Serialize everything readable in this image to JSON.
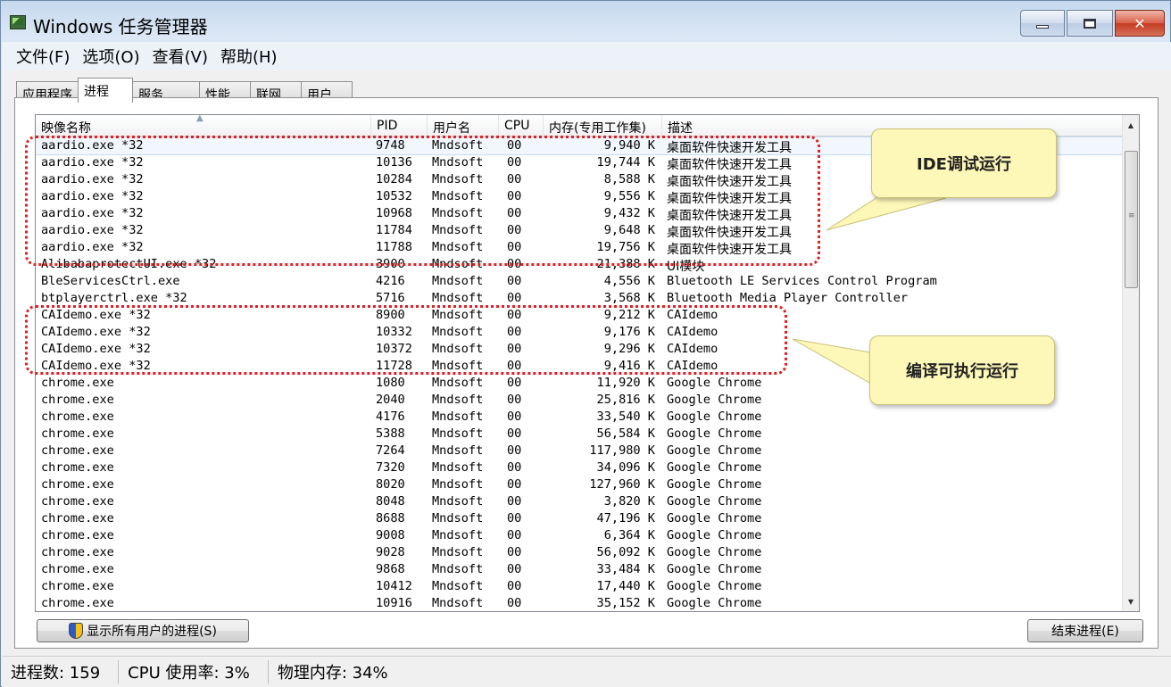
{
  "window": {
    "title": "Windows 任务管理器",
    "minimize_label": "",
    "maximize_label": "",
    "close_label": "✕"
  },
  "menu": [
    "文件(F)",
    "选项(O)",
    "查看(V)",
    "帮助(H)"
  ],
  "tabs": [
    {
      "label": "应用程序",
      "active": false
    },
    {
      "label": "进程",
      "active": true
    },
    {
      "label": "服务",
      "active": false
    },
    {
      "label": "性能",
      "active": false
    },
    {
      "label": "联网",
      "active": false
    },
    {
      "label": "用户",
      "active": false
    }
  ],
  "columns": {
    "name": "映像名称",
    "pid": "PID",
    "user": "用户名",
    "cpu": "CPU",
    "mem": "内存(专用工作集)",
    "desc": "描述"
  },
  "processes": [
    {
      "name": "aardio.exe *32",
      "pid": "9748",
      "user": "Mndsoft",
      "cpu": "00",
      "mem": "9,940 K",
      "desc": "桌面软件快速开发工具",
      "selected": true
    },
    {
      "name": "aardio.exe *32",
      "pid": "10136",
      "user": "Mndsoft",
      "cpu": "00",
      "mem": "19,744 K",
      "desc": "桌面软件快速开发工具"
    },
    {
      "name": "aardio.exe *32",
      "pid": "10284",
      "user": "Mndsoft",
      "cpu": "00",
      "mem": "8,588 K",
      "desc": "桌面软件快速开发工具"
    },
    {
      "name": "aardio.exe *32",
      "pid": "10532",
      "user": "Mndsoft",
      "cpu": "00",
      "mem": "9,556 K",
      "desc": "桌面软件快速开发工具"
    },
    {
      "name": "aardio.exe *32",
      "pid": "10968",
      "user": "Mndsoft",
      "cpu": "00",
      "mem": "9,432 K",
      "desc": "桌面软件快速开发工具"
    },
    {
      "name": "aardio.exe *32",
      "pid": "11784",
      "user": "Mndsoft",
      "cpu": "00",
      "mem": "9,648 K",
      "desc": "桌面软件快速开发工具"
    },
    {
      "name": "aardio.exe *32",
      "pid": "11788",
      "user": "Mndsoft",
      "cpu": "00",
      "mem": "19,756 K",
      "desc": "桌面软件快速开发工具"
    },
    {
      "name": "AlibabaprotectUI.exe *32",
      "pid": "3900",
      "user": "Mndsoft",
      "cpu": "00",
      "mem": "21,388 K",
      "desc": "UI模块"
    },
    {
      "name": "BleServicesCtrl.exe",
      "pid": "4216",
      "user": "Mndsoft",
      "cpu": "00",
      "mem": "4,556 K",
      "desc": "Bluetooth LE Services Control Program"
    },
    {
      "name": "btplayerctrl.exe *32",
      "pid": "5716",
      "user": "Mndsoft",
      "cpu": "00",
      "mem": "3,568 K",
      "desc": "Bluetooth Media Player Controller"
    },
    {
      "name": "CAIdemo.exe *32",
      "pid": "8900",
      "user": "Mndsoft",
      "cpu": "00",
      "mem": "9,212 K",
      "desc": "CAIdemo"
    },
    {
      "name": "CAIdemo.exe *32",
      "pid": "10332",
      "user": "Mndsoft",
      "cpu": "00",
      "mem": "9,176 K",
      "desc": "CAIdemo"
    },
    {
      "name": "CAIdemo.exe *32",
      "pid": "10372",
      "user": "Mndsoft",
      "cpu": "00",
      "mem": "9,296 K",
      "desc": "CAIdemo"
    },
    {
      "name": "CAIdemo.exe *32",
      "pid": "11728",
      "user": "Mndsoft",
      "cpu": "00",
      "mem": "9,416 K",
      "desc": "CAIdemo"
    },
    {
      "name": "chrome.exe",
      "pid": "1080",
      "user": "Mndsoft",
      "cpu": "00",
      "mem": "11,920 K",
      "desc": "Google Chrome"
    },
    {
      "name": "chrome.exe",
      "pid": "2040",
      "user": "Mndsoft",
      "cpu": "00",
      "mem": "25,816 K",
      "desc": "Google Chrome"
    },
    {
      "name": "chrome.exe",
      "pid": "4176",
      "user": "Mndsoft",
      "cpu": "00",
      "mem": "33,540 K",
      "desc": "Google Chrome"
    },
    {
      "name": "chrome.exe",
      "pid": "5388",
      "user": "Mndsoft",
      "cpu": "00",
      "mem": "56,584 K",
      "desc": "Google Chrome"
    },
    {
      "name": "chrome.exe",
      "pid": "7264",
      "user": "Mndsoft",
      "cpu": "00",
      "mem": "117,980 K",
      "desc": "Google Chrome"
    },
    {
      "name": "chrome.exe",
      "pid": "7320",
      "user": "Mndsoft",
      "cpu": "00",
      "mem": "34,096 K",
      "desc": "Google Chrome"
    },
    {
      "name": "chrome.exe",
      "pid": "8020",
      "user": "Mndsoft",
      "cpu": "00",
      "mem": "127,960 K",
      "desc": "Google Chrome"
    },
    {
      "name": "chrome.exe",
      "pid": "8048",
      "user": "Mndsoft",
      "cpu": "00",
      "mem": "3,820 K",
      "desc": "Google Chrome"
    },
    {
      "name": "chrome.exe",
      "pid": "8688",
      "user": "Mndsoft",
      "cpu": "00",
      "mem": "47,196 K",
      "desc": "Google Chrome"
    },
    {
      "name": "chrome.exe",
      "pid": "9008",
      "user": "Mndsoft",
      "cpu": "00",
      "mem": "6,364 K",
      "desc": "Google Chrome"
    },
    {
      "name": "chrome.exe",
      "pid": "9028",
      "user": "Mndsoft",
      "cpu": "00",
      "mem": "56,092 K",
      "desc": "Google Chrome"
    },
    {
      "name": "chrome.exe",
      "pid": "9868",
      "user": "Mndsoft",
      "cpu": "00",
      "mem": "33,484 K",
      "desc": "Google Chrome"
    },
    {
      "name": "chrome.exe",
      "pid": "10412",
      "user": "Mndsoft",
      "cpu": "00",
      "mem": "17,440 K",
      "desc": "Google Chrome"
    },
    {
      "name": "chrome.exe",
      "pid": "10916",
      "user": "Mndsoft",
      "cpu": "00",
      "mem": "35,152 K",
      "desc": "Google Chrome"
    }
  ],
  "buttons": {
    "show_all": "显示所有用户的进程(S)",
    "end_process": "结束进程(E)"
  },
  "status": {
    "processes": "进程数: 159",
    "cpu": "CPU 使用率: 3%",
    "memory": "物理内存: 34%"
  },
  "annotations": {
    "ide_callout": "IDE调试运行",
    "compile_callout": "编译可执行运行"
  },
  "colors": {
    "annotation_border": "#e02020",
    "callout_fill": "#fdf7b8"
  }
}
